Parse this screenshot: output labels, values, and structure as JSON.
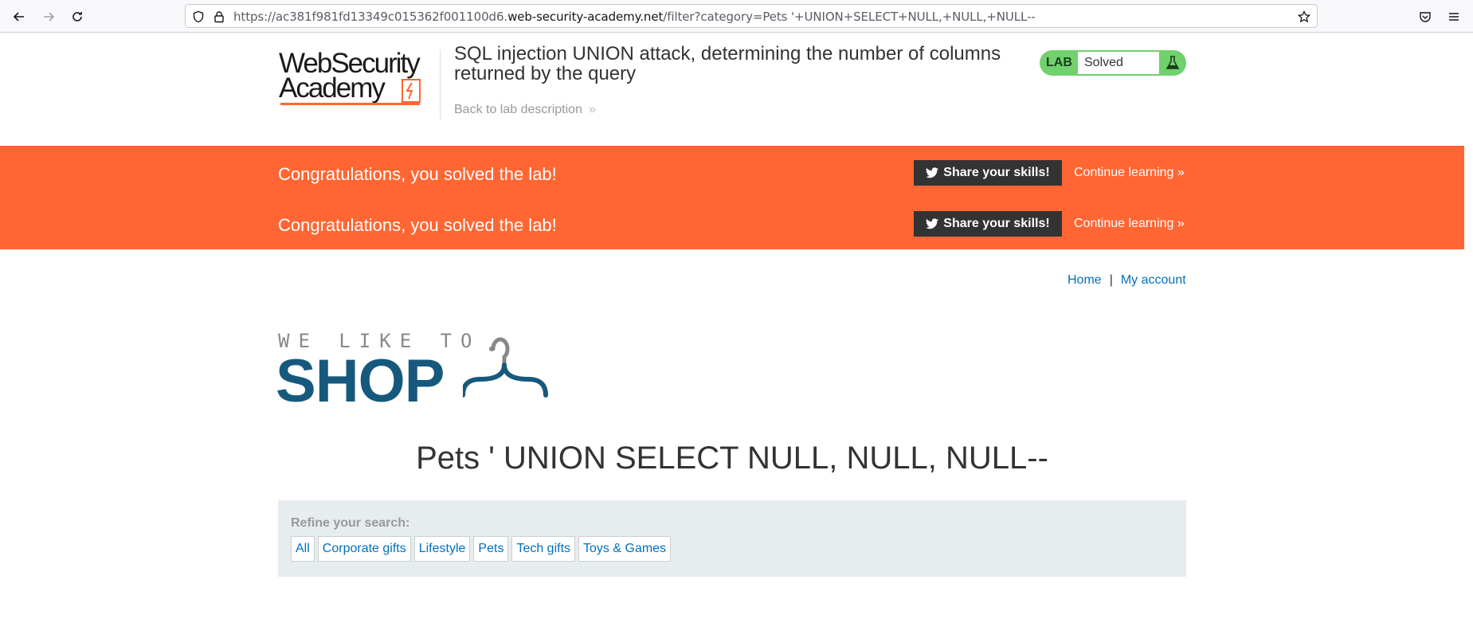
{
  "browser": {
    "url_prefix": "https://ac381f981fd13349c015362f001100d6.",
    "url_host": "web-security-academy.net",
    "url_path": "/filter?category=Pets '+UNION+SELECT+NULL,+NULL,+NULL--",
    "icons": [
      "back-icon",
      "forward-icon",
      "reload-icon",
      "shield-icon",
      "lock-icon",
      "star-icon",
      "pocket-icon",
      "menu-icon"
    ]
  },
  "lab": {
    "logo_line1": "WebSecurity",
    "logo_line2": "Academy",
    "title": "SQL injection UNION attack, determining the number of columns returned by the query",
    "back_link": "Back to lab description",
    "status_label": "LAB",
    "status_value": "Solved"
  },
  "banner": {
    "rows": [
      {
        "message": "Congratulations, you solved the lab!",
        "share": "Share your skills!",
        "continue": "Continue learning"
      },
      {
        "message": "Congratulations, you solved the lab!",
        "share": "Share your skills!",
        "continue": "Continue learning"
      }
    ]
  },
  "nav": {
    "home": "Home",
    "separator": "|",
    "account": "My account"
  },
  "shop": {
    "tagline": "WE LIKE TO",
    "word": "SHOP"
  },
  "heading": "Pets ' UNION SELECT NULL, NULL, NULL--",
  "filter": {
    "label": "Refine your search:",
    "categories": [
      "All",
      "Corporate gifts",
      "Lifestyle",
      "Pets",
      "Tech gifts",
      "Toys & Games"
    ]
  },
  "colors": {
    "accent_orange": "#ff6633",
    "lab_green": "#70d16d",
    "link_blue": "#0071bc",
    "shop_blue": "#17597d"
  }
}
